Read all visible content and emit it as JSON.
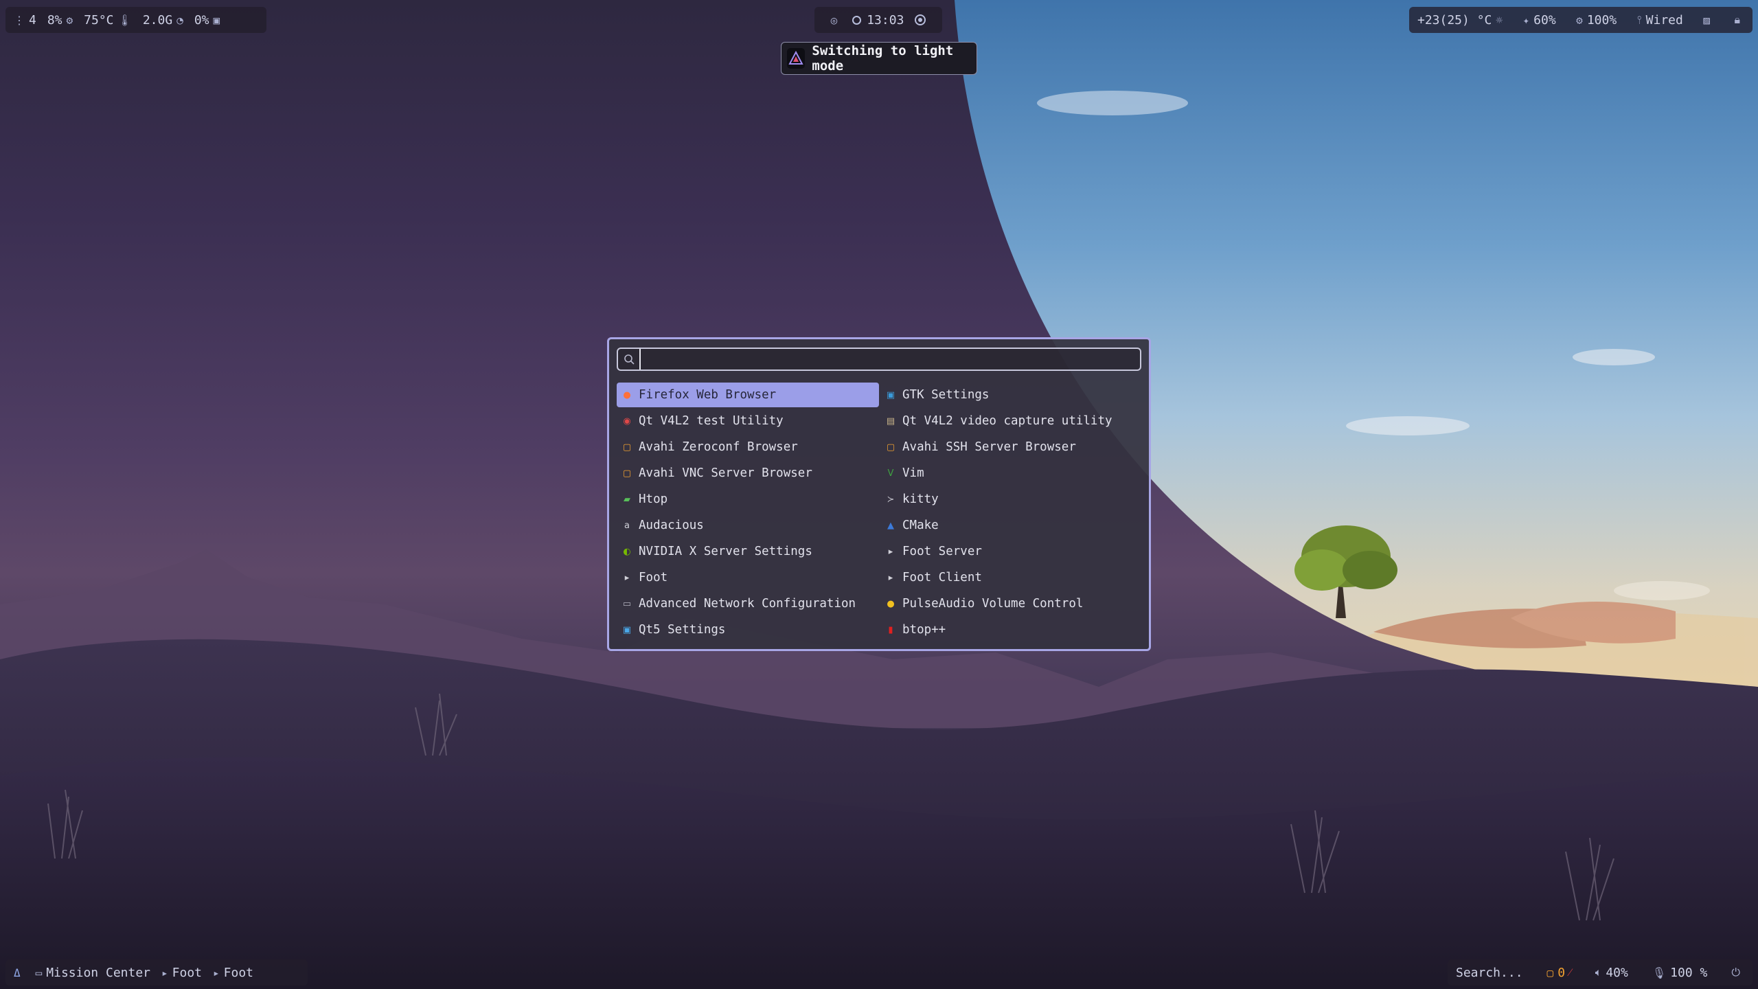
{
  "top_bar": {
    "left": {
      "workspace": "4",
      "cpu": "8%",
      "temperature": "75°C",
      "memory": "2.0G",
      "disk": "0%"
    },
    "center": {
      "time": "13:03"
    },
    "right": {
      "weather": "+23(25) °C",
      "brightness": "60%",
      "battery": "100%",
      "network": "Wired"
    }
  },
  "tooltip": {
    "text": "Switching to light mode"
  },
  "launcher": {
    "search_value": "",
    "apps": [
      {
        "label": "Firefox Web Browser",
        "icon": "firefox-icon",
        "color": "#ff7139",
        "selected": true
      },
      {
        "label": "GTK Settings",
        "icon": "gtk-settings-icon",
        "color": "#3a9ad9"
      },
      {
        "label": "Qt V4L2 test Utility",
        "icon": "qv4l2-icon",
        "color": "#e04848"
      },
      {
        "label": "Qt V4L2 video capture utility",
        "icon": "qvidcap-icon",
        "color": "#c8b48a"
      },
      {
        "label": "Avahi Zeroconf Browser",
        "icon": "avahi-icon",
        "color": "#f0a030"
      },
      {
        "label": "Avahi SSH Server Browser",
        "icon": "avahi-icon",
        "color": "#f0a030"
      },
      {
        "label": "Avahi VNC Server Browser",
        "icon": "avahi-icon",
        "color": "#f0a030"
      },
      {
        "label": "Vim",
        "icon": "vim-icon",
        "color": "#3fa142"
      },
      {
        "label": "Htop",
        "icon": "htop-icon",
        "color": "#58c05a"
      },
      {
        "label": "kitty",
        "icon": "kitty-icon",
        "color": "#c0c0c8"
      },
      {
        "label": "Audacious",
        "icon": "audacious-icon",
        "color": "#d0d0d8"
      },
      {
        "label": "CMake",
        "icon": "cmake-icon",
        "color": "#3c7ad8"
      },
      {
        "label": "NVIDIA X Server Settings",
        "icon": "nvidia-icon",
        "color": "#76b900"
      },
      {
        "label": "Foot Server",
        "icon": "terminal-icon",
        "color": "#d0d0d8"
      },
      {
        "label": "Foot",
        "icon": "terminal-icon",
        "color": "#d0d0d8"
      },
      {
        "label": "Foot Client",
        "icon": "terminal-icon",
        "color": "#d0d0d8"
      },
      {
        "label": "Advanced Network Configuration",
        "icon": "network-icon",
        "color": "#b0b0bc"
      },
      {
        "label": "PulseAudio Volume Control",
        "icon": "pulseaudio-icon",
        "color": "#f0c020"
      },
      {
        "label": "Qt5 Settings",
        "icon": "qt5-settings-icon",
        "color": "#4aa8e8"
      },
      {
        "label": "btop++",
        "icon": "btop-icon",
        "color": "#e02020"
      }
    ]
  },
  "bottom_bar": {
    "left": {
      "windows": [
        "Mission Center",
        "Foot",
        "Foot"
      ]
    },
    "right": {
      "search_placeholder": "Search...",
      "notifications": "0",
      "volume": "40%",
      "mic": "100 %"
    }
  },
  "colors": {
    "accent": "#9b9ee8",
    "launcher_border": "#a8a6e6",
    "bar_text": "#cfd2e6",
    "notification_count": "#f0a030"
  }
}
